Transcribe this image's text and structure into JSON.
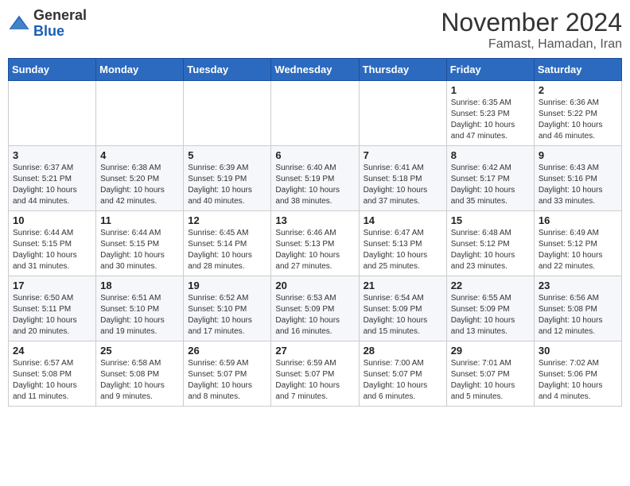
{
  "logo": {
    "general": "General",
    "blue": "Blue"
  },
  "header": {
    "month": "November 2024",
    "location": "Famast, Hamadan, Iran"
  },
  "weekdays": [
    "Sunday",
    "Monday",
    "Tuesday",
    "Wednesday",
    "Thursday",
    "Friday",
    "Saturday"
  ],
  "weeks": [
    [
      null,
      null,
      null,
      null,
      null,
      {
        "day": "1",
        "sunrise": "6:35 AM",
        "sunset": "5:23 PM",
        "daylight": "10 hours and 47 minutes."
      },
      {
        "day": "2",
        "sunrise": "6:36 AM",
        "sunset": "5:22 PM",
        "daylight": "10 hours and 46 minutes."
      }
    ],
    [
      {
        "day": "3",
        "sunrise": "6:37 AM",
        "sunset": "5:21 PM",
        "daylight": "10 hours and 44 minutes."
      },
      {
        "day": "4",
        "sunrise": "6:38 AM",
        "sunset": "5:20 PM",
        "daylight": "10 hours and 42 minutes."
      },
      {
        "day": "5",
        "sunrise": "6:39 AM",
        "sunset": "5:19 PM",
        "daylight": "10 hours and 40 minutes."
      },
      {
        "day": "6",
        "sunrise": "6:40 AM",
        "sunset": "5:19 PM",
        "daylight": "10 hours and 38 minutes."
      },
      {
        "day": "7",
        "sunrise": "6:41 AM",
        "sunset": "5:18 PM",
        "daylight": "10 hours and 37 minutes."
      },
      {
        "day": "8",
        "sunrise": "6:42 AM",
        "sunset": "5:17 PM",
        "daylight": "10 hours and 35 minutes."
      },
      {
        "day": "9",
        "sunrise": "6:43 AM",
        "sunset": "5:16 PM",
        "daylight": "10 hours and 33 minutes."
      }
    ],
    [
      {
        "day": "10",
        "sunrise": "6:44 AM",
        "sunset": "5:15 PM",
        "daylight": "10 hours and 31 minutes."
      },
      {
        "day": "11",
        "sunrise": "6:44 AM",
        "sunset": "5:15 PM",
        "daylight": "10 hours and 30 minutes."
      },
      {
        "day": "12",
        "sunrise": "6:45 AM",
        "sunset": "5:14 PM",
        "daylight": "10 hours and 28 minutes."
      },
      {
        "day": "13",
        "sunrise": "6:46 AM",
        "sunset": "5:13 PM",
        "daylight": "10 hours and 27 minutes."
      },
      {
        "day": "14",
        "sunrise": "6:47 AM",
        "sunset": "5:13 PM",
        "daylight": "10 hours and 25 minutes."
      },
      {
        "day": "15",
        "sunrise": "6:48 AM",
        "sunset": "5:12 PM",
        "daylight": "10 hours and 23 minutes."
      },
      {
        "day": "16",
        "sunrise": "6:49 AM",
        "sunset": "5:12 PM",
        "daylight": "10 hours and 22 minutes."
      }
    ],
    [
      {
        "day": "17",
        "sunrise": "6:50 AM",
        "sunset": "5:11 PM",
        "daylight": "10 hours and 20 minutes."
      },
      {
        "day": "18",
        "sunrise": "6:51 AM",
        "sunset": "5:10 PM",
        "daylight": "10 hours and 19 minutes."
      },
      {
        "day": "19",
        "sunrise": "6:52 AM",
        "sunset": "5:10 PM",
        "daylight": "10 hours and 17 minutes."
      },
      {
        "day": "20",
        "sunrise": "6:53 AM",
        "sunset": "5:09 PM",
        "daylight": "10 hours and 16 minutes."
      },
      {
        "day": "21",
        "sunrise": "6:54 AM",
        "sunset": "5:09 PM",
        "daylight": "10 hours and 15 minutes."
      },
      {
        "day": "22",
        "sunrise": "6:55 AM",
        "sunset": "5:09 PM",
        "daylight": "10 hours and 13 minutes."
      },
      {
        "day": "23",
        "sunrise": "6:56 AM",
        "sunset": "5:08 PM",
        "daylight": "10 hours and 12 minutes."
      }
    ],
    [
      {
        "day": "24",
        "sunrise": "6:57 AM",
        "sunset": "5:08 PM",
        "daylight": "10 hours and 11 minutes."
      },
      {
        "day": "25",
        "sunrise": "6:58 AM",
        "sunset": "5:08 PM",
        "daylight": "10 hours and 9 minutes."
      },
      {
        "day": "26",
        "sunrise": "6:59 AM",
        "sunset": "5:07 PM",
        "daylight": "10 hours and 8 minutes."
      },
      {
        "day": "27",
        "sunrise": "6:59 AM",
        "sunset": "5:07 PM",
        "daylight": "10 hours and 7 minutes."
      },
      {
        "day": "28",
        "sunrise": "7:00 AM",
        "sunset": "5:07 PM",
        "daylight": "10 hours and 6 minutes."
      },
      {
        "day": "29",
        "sunrise": "7:01 AM",
        "sunset": "5:07 PM",
        "daylight": "10 hours and 5 minutes."
      },
      {
        "day": "30",
        "sunrise": "7:02 AM",
        "sunset": "5:06 PM",
        "daylight": "10 hours and 4 minutes."
      }
    ]
  ]
}
